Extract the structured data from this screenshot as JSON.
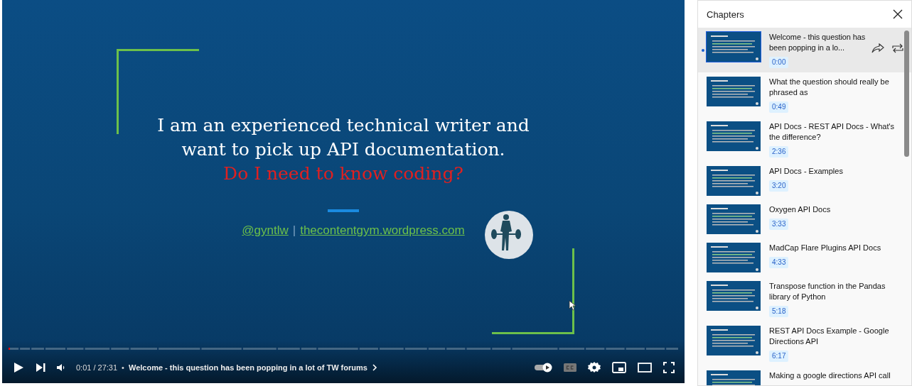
{
  "player": {
    "slide": {
      "heading": "I am an experienced technical writer and want to pick up API documentation.",
      "question": "Do I need to know coding?",
      "handle": "@gyntlw",
      "separator": "|",
      "website": "thecontentgym.wordpress.com"
    },
    "progress": {
      "level": 0.001
    },
    "time": "0:01 / 27:31",
    "bullet": "•",
    "chapter_title": "Welcome - this question has been popping in a lot of TW forums",
    "autoplay": {
      "on": true
    },
    "captions": {
      "on": false
    }
  },
  "chapters": {
    "title": "Chapters",
    "items": [
      {
        "title": "Welcome - this question has been popping in a lo...",
        "time": "0:00",
        "selected": true
      },
      {
        "title": "What the question should really be phrased as",
        "time": "0:49",
        "selected": false
      },
      {
        "title": "API Docs - REST API Docs - What's the difference?",
        "time": "2:36",
        "selected": false
      },
      {
        "title": "API Docs - Examples",
        "time": "3:20",
        "selected": false
      },
      {
        "title": "Oxygen API Docs",
        "time": "3:33",
        "selected": false
      },
      {
        "title": "MadCap Flare Plugins API Docs",
        "time": "4:33",
        "selected": false
      },
      {
        "title": "Transpose function in the Pandas library of Python",
        "time": "5:18",
        "selected": false
      },
      {
        "title": "REST API Docs Example - Google Directions API",
        "time": "6:17",
        "selected": false
      },
      {
        "title": "Making a google directions API call",
        "selected": false
      }
    ]
  }
}
